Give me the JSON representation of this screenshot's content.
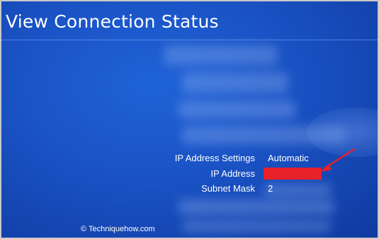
{
  "screen": {
    "title": "View Connection Status"
  },
  "fields": [
    {
      "label": "IP Address Settings",
      "value": "Automatic"
    },
    {
      "label": "IP Address",
      "value": ""
    },
    {
      "label": "Subnet Mask",
      "value": "2"
    }
  ],
  "footer": {
    "watermark": "© Techniquehow.com"
  },
  "colors": {
    "background": "#1a52c4",
    "redaction": "#e8202a",
    "annotation_arrow": "#e8202a"
  }
}
